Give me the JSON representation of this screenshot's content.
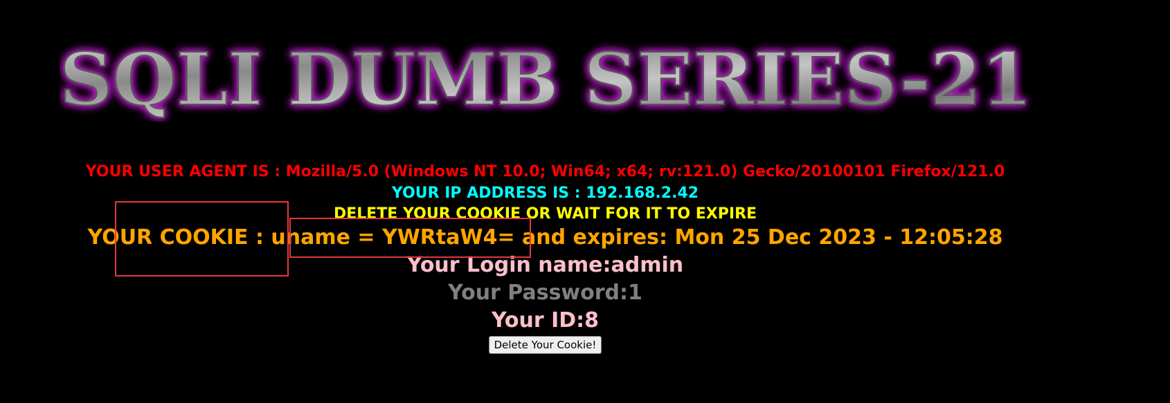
{
  "banner": {
    "title": "SQLI DUMB SERIES-21",
    "glow_color": "#c020d0",
    "fill_color": "#a0a0a0"
  },
  "info": {
    "user_agent": "YOUR USER AGENT IS : Mozilla/5.0 (Windows NT 10.0; Win64; x64; rv:121.0) Gecko/20100101 Firefox/121.0",
    "ip_address": "YOUR IP ADDRESS IS : 192.168.2.42",
    "delete_message": "DELETE YOUR COOKIE OR WAIT FOR IT TO EXPIRE",
    "cookie": "YOUR COOKIE : uname = YWRtaW4= and expires: Mon 25 Dec 2023 - 12:05:28",
    "login_name": "Your Login name:admin",
    "password": "Your Password:1",
    "user_id": "Your ID:8"
  },
  "actions": {
    "delete_cookie_label": "Delete Your Cookie!"
  },
  "colors": {
    "user_agent": "#ff0000",
    "ip_address": "#00ffff",
    "delete_message": "#ffff00",
    "cookie": "#ffa500",
    "login_name": "#ffc0cb",
    "password": "#808080",
    "user_id": "#ffc0cb",
    "annotation": "#e5393b"
  }
}
